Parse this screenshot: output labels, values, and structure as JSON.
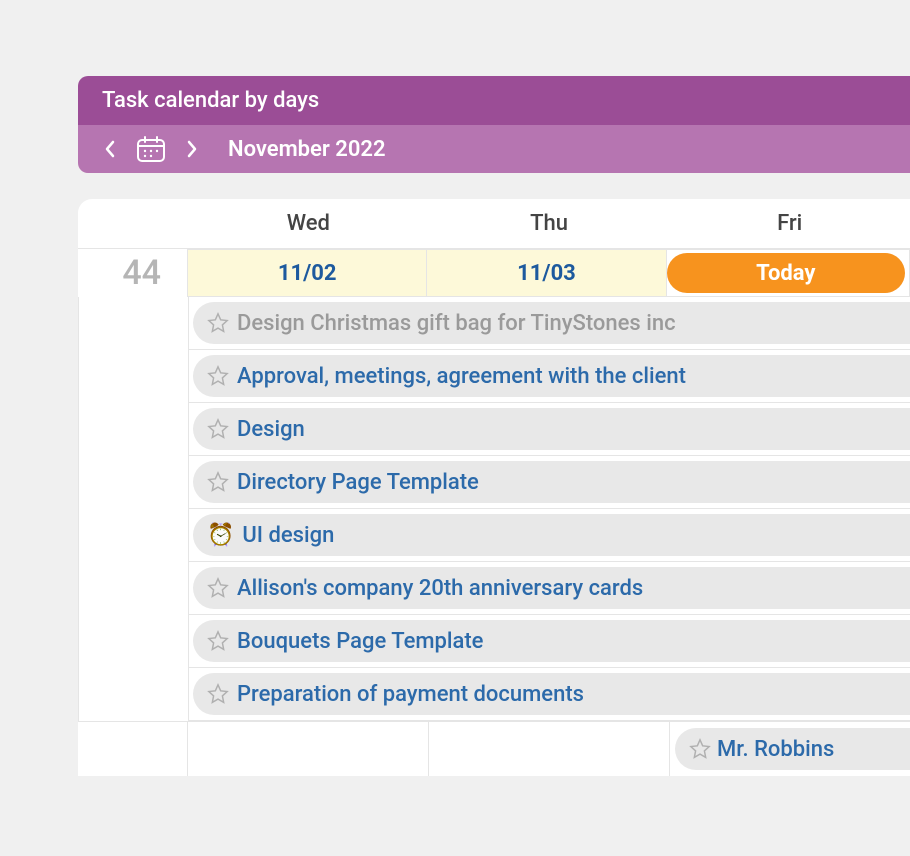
{
  "header": {
    "title": "Task calendar by days",
    "period": "November 2022"
  },
  "days": [
    "Wed",
    "Thu",
    "Fri"
  ],
  "week_number": "44",
  "dates": [
    {
      "label": "11/02",
      "today": false
    },
    {
      "label": "11/03",
      "today": false
    },
    {
      "label": "Today",
      "today": true
    }
  ],
  "tasks": [
    {
      "label": "Design Christmas gift bag for TinyStones inc",
      "muted": true,
      "icon": "star"
    },
    {
      "label": "Approval, meetings, agreement with the client",
      "muted": false,
      "icon": "star"
    },
    {
      "label": "Design",
      "muted": false,
      "icon": "star"
    },
    {
      "label": "Directory Page Template",
      "muted": false,
      "icon": "star"
    },
    {
      "label": "UI design",
      "muted": false,
      "icon": "clock"
    },
    {
      "label": "Allison's company 20th anniversary cards",
      "muted": false,
      "icon": "star"
    },
    {
      "label": "Bouquets Page Template",
      "muted": false,
      "icon": "star"
    },
    {
      "label": "Preparation of payment documents",
      "muted": false,
      "icon": "star"
    }
  ],
  "bottom_task": {
    "label": "Mr. Robbins"
  }
}
